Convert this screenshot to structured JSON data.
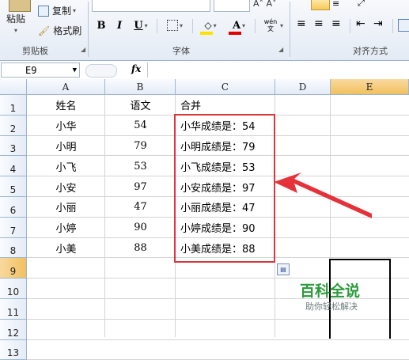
{
  "ribbon": {
    "clipboard": {
      "paste_label": "粘贴",
      "copy_label": "复制",
      "format_painter_label": "格式刷",
      "group_label": "剪贴板"
    },
    "font": {
      "group_label": "字体",
      "bold": "B",
      "italic": "I",
      "underline": "U",
      "font_color_glyph": "A",
      "wen_glyph": "wén 文",
      "fill_color": "#ffe100",
      "font_color": "#e00000"
    },
    "alignment": {
      "group_label": "对齐方式"
    }
  },
  "formula_bar": {
    "name_box": "E9",
    "fx_label": "fx",
    "value": ""
  },
  "sheet": {
    "columns": [
      "A",
      "B",
      "C",
      "D",
      "E"
    ],
    "rows": [
      "1",
      "2",
      "3",
      "4",
      "5",
      "6",
      "7",
      "8",
      "9",
      "10",
      "11",
      "12",
      "13"
    ],
    "data": [
      [
        "姓名",
        "语文",
        "合并"
      ],
      [
        "小华",
        "54",
        "小华成绩是：54"
      ],
      [
        "小明",
        "79",
        "小明成绩是：79"
      ],
      [
        "小飞",
        "53",
        "小飞成绩是：53"
      ],
      [
        "小安",
        "97",
        "小安成绩是：97"
      ],
      [
        "小丽",
        "47",
        "小丽成绩是：47"
      ],
      [
        "小婷",
        "90",
        "小婷成绩是：90"
      ],
      [
        "小美",
        "88",
        "小美成绩是：88"
      ]
    ],
    "selected_cell": "E9"
  },
  "annotation": {
    "box_color": "#d9363e",
    "arrow_color": "#e5323a"
  },
  "watermark": {
    "title": "百科全说",
    "subtitle": "助你轻松解决"
  }
}
